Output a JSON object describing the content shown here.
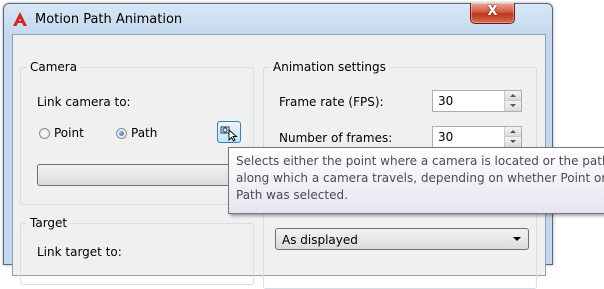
{
  "window": {
    "title": "Motion Path Animation",
    "close_glyph": "X",
    "app_icon": "autocad-a-icon",
    "close_icon": "close-icon"
  },
  "camera": {
    "group_label": "Camera",
    "link_label": "Link camera to:",
    "point_label": "Point",
    "path_label": "Path",
    "selected": "Path",
    "pick_icon": "pick-object-cursor-icon",
    "combo_value": ""
  },
  "target": {
    "group_label": "Target",
    "link_label": "Link target to:"
  },
  "animation": {
    "group_label": "Animation settings",
    "frame_rate_label": "Frame rate (FPS):",
    "frame_rate_value": "30",
    "frames_label": "Number of frames:",
    "frames_value": "30",
    "visual_style_value": "As displayed"
  },
  "tooltip": {
    "lines": [
      "Selects either the point where a camera is located or the path",
      "along which a camera travels, depending on whether Point or",
      "Path was selected."
    ]
  },
  "colors": {
    "title_gradient": "#d9e7f6",
    "close_button": "#c1361b",
    "icon_red": "#d9261c",
    "client_bg": "#f0f0f0"
  }
}
